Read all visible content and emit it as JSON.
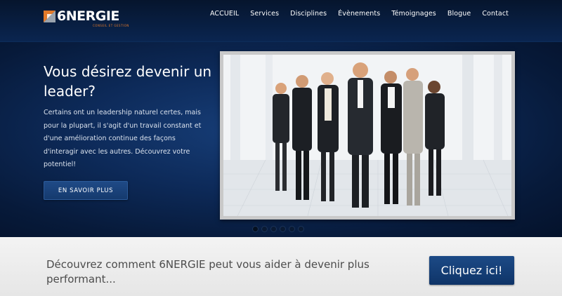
{
  "header": {
    "logo": {
      "title": "6NERGIE",
      "subtitle": "CONSEIL ET GESTION",
      "icon": "logo-mark-icon"
    },
    "nav": [
      {
        "label": "ACCUEIL"
      },
      {
        "label": "Services"
      },
      {
        "label": "Disciplines"
      },
      {
        "label": "Évènements"
      },
      {
        "label": "Témoignages"
      },
      {
        "label": "Blogue"
      },
      {
        "label": "Contact"
      }
    ]
  },
  "hero": {
    "title": "Vous désirez devenir un leader?",
    "body": "Certains ont un leadership naturel certes, mais pour la plupart, il s'agit d'un travail constant et d'une amélioration continue des façons d'interagir avec les autres. Découvrez votre potentiel!",
    "button_label": "EN SAVOIR PLUS",
    "slides": {
      "count": 6,
      "active_index": 0
    }
  },
  "promo": {
    "text": "Découvrez comment 6NERGIE peut vous aider à devenir plus performant...",
    "button_label": "Cliquez ici!"
  },
  "colors": {
    "header_bg": "#06152d",
    "hero_bg": "#0d2a59",
    "accent_orange": "#e37a2a",
    "button_blue": "#153a6e",
    "promo_bg": "#ececec"
  }
}
